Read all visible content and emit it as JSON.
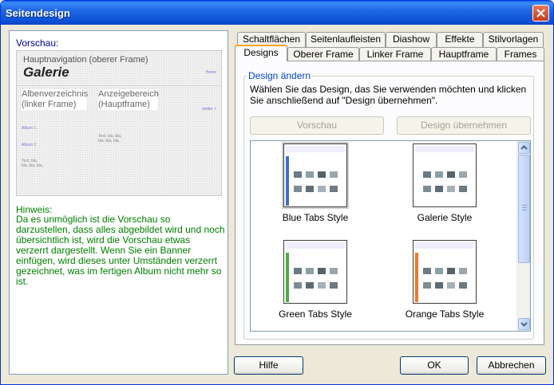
{
  "window": {
    "title": "Seitendesign"
  },
  "preview": {
    "label": "Vorschau:",
    "nav_title": "Hauptnavigation (oberer Frame)",
    "album_name": "Galerie",
    "home_link": "Home",
    "albums_line1": "Albenverzeichnis",
    "albums_line2": "(linker Frame)",
    "display_line1": "Anzeigebereich",
    "display_line2": "(Hauptframe)",
    "weiter_link": "weiter >",
    "album1": "Album 1",
    "album2": "Album 2",
    "text_left": "Text, bla, bla, bla, bla,",
    "text_right": "Text, bla, bla, bla, bla, bla,"
  },
  "hint": {
    "label": "Hinweis:",
    "text": "Da es unmöglich ist die Vorschau so darzustellen, dass alles abgebildet wird und noch übersichtlich ist, wird die Vorschau etwas verzerrt dargestellt. Wenn Sie ein Banner einfügen, wird dieses unter Umständen verzerrt gezeichnet, was im fertigen Album nicht mehr so ist."
  },
  "tabs_row1": [
    "Schaltflächen",
    "Seitenlaufleisten",
    "Diashow",
    "Effekte",
    "Stilvorlagen"
  ],
  "tabs_row2": [
    "Designs",
    "Oberer Frame",
    "Linker Frame",
    "Hauptframe",
    "Frames"
  ],
  "active_tab": "Designs",
  "design_group": {
    "legend": "Design ändern",
    "instruction": "Wählen Sie das Design, das Sie verwenden möchten und klicken Sie anschließend auf \"Design übernehmen\".",
    "preview_button": "Vorschau",
    "apply_button": "Design übernehmen",
    "designs": [
      {
        "name": "Blue Tabs Style",
        "accent": "#3a6fd8"
      },
      {
        "name": "Galerie Style",
        "accent": "#c8c8c8"
      },
      {
        "name": "Green Tabs Style",
        "accent": "#4caf3c"
      },
      {
        "name": "Orange Tabs Style",
        "accent": "#f07a2a"
      }
    ]
  },
  "footer": {
    "help_button": "Hilfe",
    "ok_button": "OK",
    "cancel_button": "Abbrechen"
  }
}
